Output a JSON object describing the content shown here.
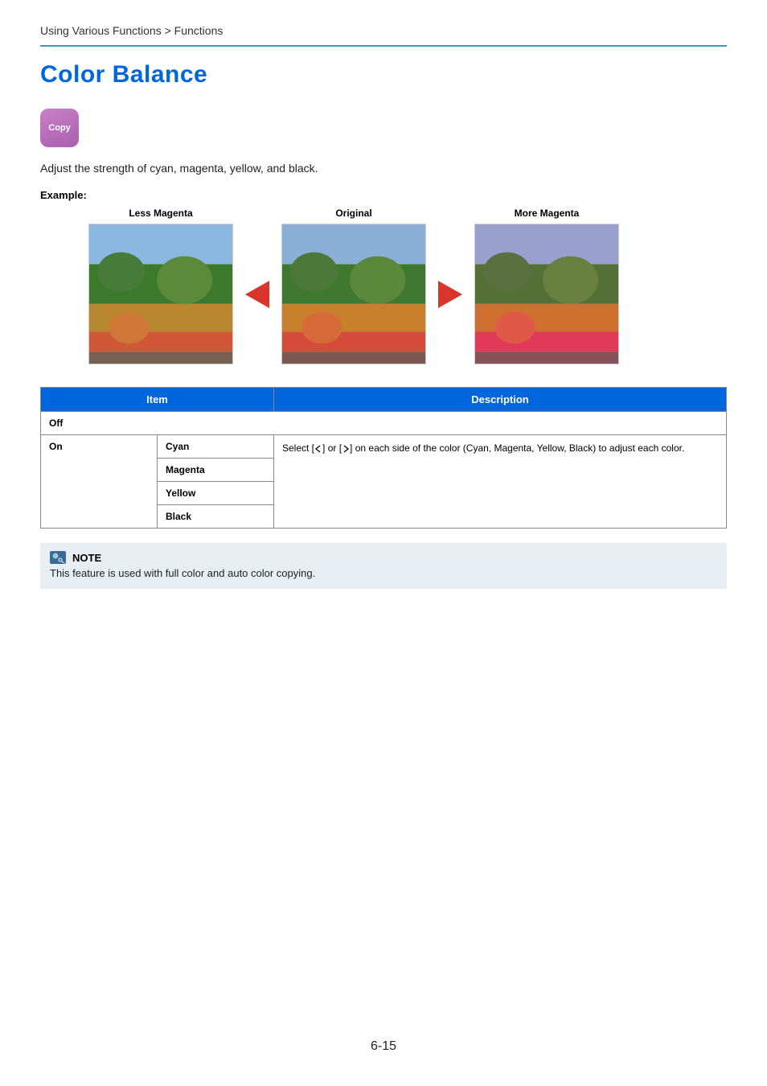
{
  "breadcrumb": "Using Various Functions > Functions",
  "title": "Color Balance",
  "badge": "Copy",
  "intro": "Adjust the strength of cyan, magenta, yellow, and black.",
  "example_label": "Example:",
  "examples": {
    "less": "Less Magenta",
    "original": "Original",
    "more": "More Magenta"
  },
  "table": {
    "headers": {
      "item": "Item",
      "description": "Description"
    },
    "row_off": "Off",
    "row_on": "On",
    "colors": {
      "cyan": "Cyan",
      "magenta": "Magenta",
      "yellow": "Yellow",
      "black": "Black"
    },
    "desc_prefix": "Select [",
    "desc_middle": "] or [",
    "desc_suffix": "] on each side of the color (Cyan, Magenta, Yellow, Black) to adjust each color."
  },
  "note": {
    "title": "NOTE",
    "body": "This feature is used with full color and auto color copying."
  },
  "page_number": "6-15"
}
